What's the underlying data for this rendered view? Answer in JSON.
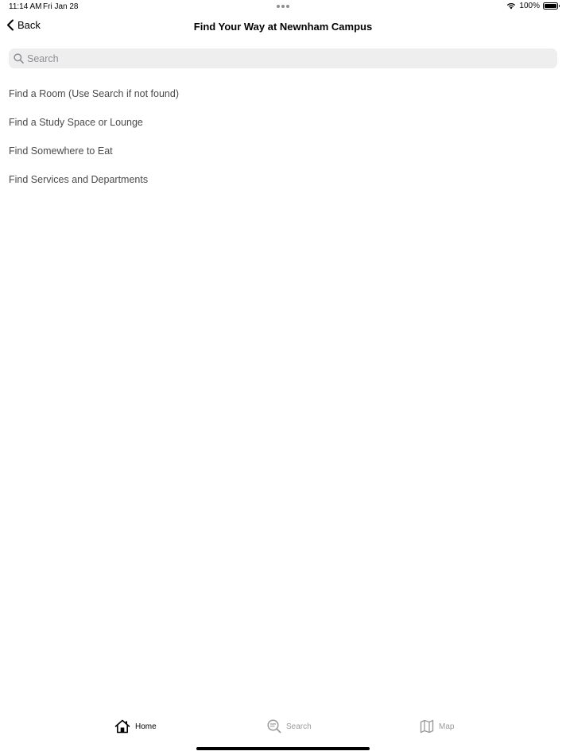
{
  "status_bar": {
    "time": "11:14 AM",
    "date": "Fri Jan 28",
    "battery_percent": "100%",
    "battery_level": 1.0
  },
  "nav": {
    "back_label": "Back",
    "title": "Find Your Way at Newnham Campus"
  },
  "search": {
    "placeholder": "Search",
    "value": ""
  },
  "menu": {
    "items": [
      {
        "label": "Find a Room (Use Search if not found)"
      },
      {
        "label": "Find a Study Space or Lounge"
      },
      {
        "label": "Find Somewhere to Eat"
      },
      {
        "label": "Find Services and Departments"
      }
    ]
  },
  "tabs": [
    {
      "label": "Home",
      "icon": "house-icon",
      "selected": true
    },
    {
      "label": "Search",
      "icon": "search-bubble-icon",
      "selected": false
    },
    {
      "label": "Map",
      "icon": "map-icon",
      "selected": false
    }
  ],
  "colors": {
    "selected_tab": "#000000",
    "unselected_tab": "#9a9a9a",
    "search_field_bg": "#eeeeef",
    "list_text": "#4a4a4a"
  }
}
